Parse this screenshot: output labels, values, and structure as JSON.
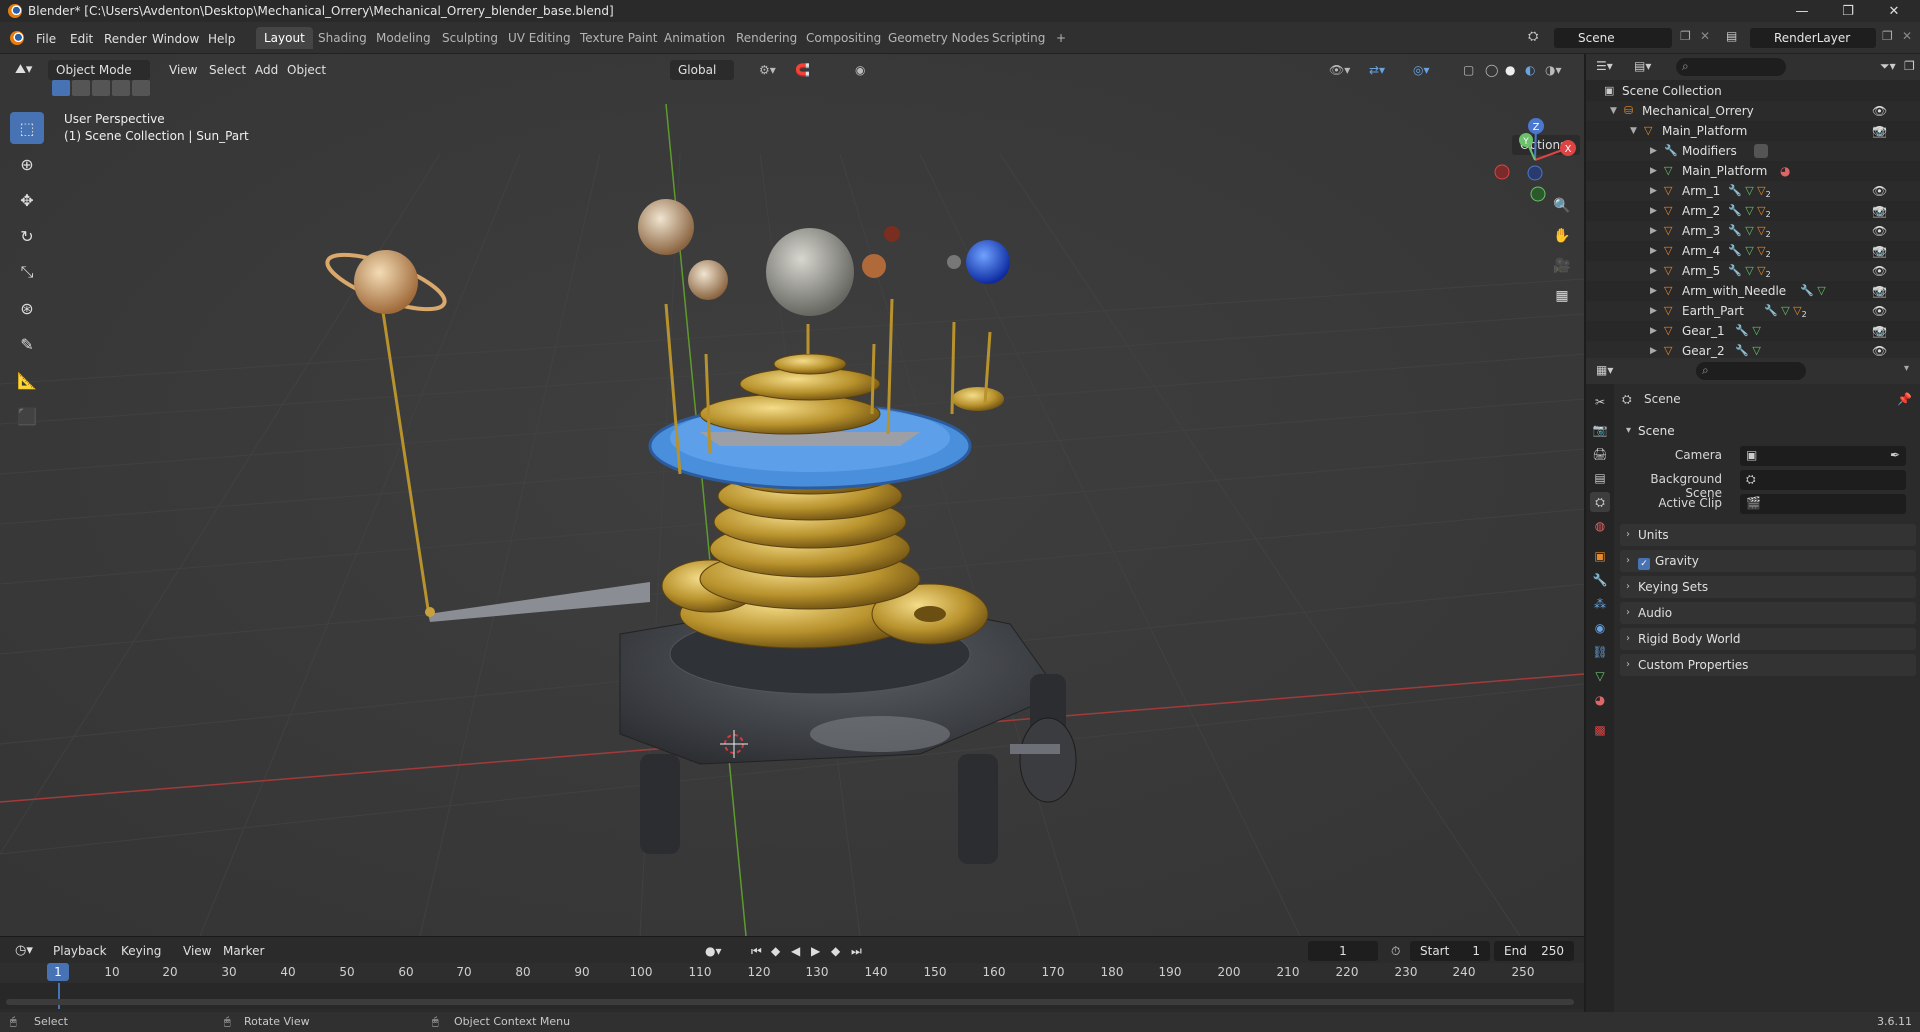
{
  "window": {
    "title": "Blender* [C:\\Users\\Avdenton\\Desktop\\Mechanical_Orrery\\Mechanical_Orrery_blender_base.blend]",
    "minimize": "—",
    "maximize": "❐",
    "close": "✕"
  },
  "menu": {
    "file": "File",
    "edit": "Edit",
    "render": "Render",
    "window": "Window",
    "help": "Help"
  },
  "workspaces": [
    "Layout",
    "Shading",
    "Modeling",
    "Sculpting",
    "UV Editing",
    "Texture Paint",
    "Animation",
    "Rendering",
    "Compositing",
    "Geometry Nodes",
    "Scripting",
    "+"
  ],
  "scene_selector": {
    "scene": "Scene",
    "view_layer": "RenderLayer"
  },
  "viewport": {
    "mode": "Object Mode",
    "view": "View",
    "select": "Select",
    "add": "Add",
    "object": "Object",
    "transform_orientation": "Global",
    "options": "Options",
    "perspective": "User Perspective",
    "collection_info": "(1) Scene Collection | Sun_Part",
    "axis_labels": {
      "x": "X",
      "y": "Y",
      "z": "Z"
    }
  },
  "timeline": {
    "playback": "Playback",
    "keying": "Keying",
    "view": "View",
    "marker": "Marker",
    "current_frame": "1",
    "start_label": "Start",
    "start": "1",
    "end_label": "End",
    "end": "250",
    "ruler": [
      "1",
      "10",
      "20",
      "30",
      "40",
      "50",
      "60",
      "70",
      "80",
      "90",
      "100",
      "110",
      "120",
      "130",
      "140",
      "150",
      "160",
      "170",
      "180",
      "190",
      "200",
      "210",
      "220",
      "230",
      "240",
      "250"
    ]
  },
  "statusbar": {
    "select": "Select",
    "rotate": "Rotate View",
    "context": "Object Context Menu",
    "version": "3.6.11"
  },
  "outliner": {
    "rows": [
      {
        "label": "Scene Collection",
        "indent": 0,
        "type": "collection"
      },
      {
        "label": "Mechanical_Orrery",
        "indent": 1,
        "type": "armature"
      },
      {
        "label": "Main_Platform",
        "indent": 2,
        "type": "object"
      },
      {
        "label": "Modifiers",
        "indent": 3,
        "type": "modifiers"
      },
      {
        "label": "Main_Platform",
        "indent": 3,
        "type": "mesh"
      },
      {
        "label": "Arm_1",
        "indent": 3,
        "type": "object"
      },
      {
        "label": "Arm_2",
        "indent": 3,
        "type": "object"
      },
      {
        "label": "Arm_3",
        "indent": 3,
        "type": "object"
      },
      {
        "label": "Arm_4",
        "indent": 3,
        "type": "object"
      },
      {
        "label": "Arm_5",
        "indent": 3,
        "type": "object"
      },
      {
        "label": "Arm_with_Needle",
        "indent": 3,
        "type": "object"
      },
      {
        "label": "Earth_Part",
        "indent": 3,
        "type": "object"
      },
      {
        "label": "Gear_1",
        "indent": 3,
        "type": "object"
      },
      {
        "label": "Gear_2",
        "indent": 3,
        "type": "object"
      }
    ],
    "badge": "2"
  },
  "properties": {
    "context_title": "Scene",
    "section": "Scene",
    "camera_label": "Camera",
    "background_label": "Background Scene",
    "clip_label": "Active Clip",
    "panels": [
      "Units",
      "Gravity",
      "Keying Sets",
      "Audio",
      "Rigid Body World",
      "Custom Properties"
    ]
  }
}
